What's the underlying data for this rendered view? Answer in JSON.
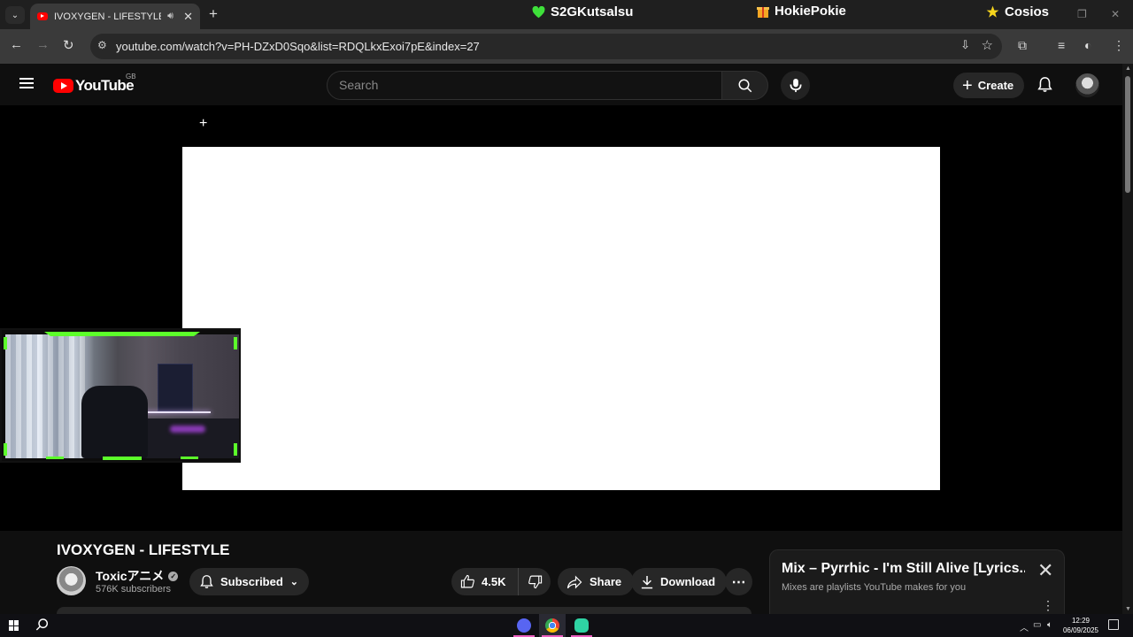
{
  "browser": {
    "tab": {
      "title": "IVOXYGEN - LIFESTYLE - YouTube",
      "audio_icon": "speaker-icon",
      "close": "✕"
    },
    "new_tab": "+",
    "overlays": [
      {
        "name": "S2GKutsalsu",
        "icon": "green-heart-icon",
        "color": "#3ee03a"
      },
      {
        "name": "HokiePokie",
        "icon": "gift-icon",
        "color": "#f5a623"
      },
      {
        "name": "Cosios",
        "icon": "star-icon",
        "color": "#f7d51d"
      }
    ],
    "url": "youtube.com/watch?v=PH-DZxD0Sqo&list=RDQLkxExoi7pE&index=27"
  },
  "masthead": {
    "logo_text": "YouTube",
    "region": "GB",
    "search_placeholder": "Search",
    "create_label": "Create"
  },
  "video": {
    "title": "IVOXYGEN - LIFESTYLE",
    "channel": "Toxicアニメ",
    "subscribers": "576K subscribers",
    "subscribe_label": "Subscribed",
    "likes": "4.5K",
    "share_label": "Share",
    "download_label": "Download"
  },
  "playlist": {
    "title": "Mix – Pyrrhic - I'm Still Alive [Lyrics...",
    "subtitle": "Mixes are playlists YouTube makes for you"
  },
  "taskbar": {
    "time": "12:29",
    "date": "06/09/2025",
    "apps": [
      "discord-icon",
      "chrome-icon",
      "app-icon"
    ]
  },
  "colors": {
    "youtube_red": "#ff0000",
    "overlay_green": "#5cff2a",
    "taskbar_underline": "#ec5fbf"
  }
}
